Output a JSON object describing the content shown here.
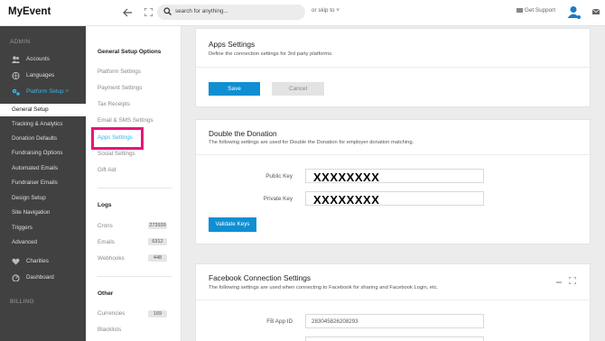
{
  "header": {
    "logo": "MyEvent",
    "search_placeholder": "search for anything...",
    "skip_label": "or skip to ˅",
    "support_label": "Get Support"
  },
  "leftnav": {
    "admin_heading": "ADMIN",
    "accounts": "Accounts",
    "languages": "Languages",
    "platform_setup": "Platform Setup ˅",
    "items": [
      "General Setup",
      "Tracking & Analytics",
      "Donation Defaults",
      "Fundraising Options",
      "Automated Emails",
      "Fundraiser Emails",
      "Design Setup",
      "Site Navigation",
      "Triggers",
      "Advanced"
    ],
    "charities": "Charities",
    "dashboard": "Dashboard",
    "billing_heading": "BILLING"
  },
  "subnav": {
    "general_heading": "General Setup Options",
    "general_links": [
      "Platform Settings",
      "Payment Settings",
      "Tax Receipts",
      "Email & SMS Settings",
      "Apps Settings",
      "Social Settings",
      "Gift Aid"
    ],
    "logs_heading": "Logs",
    "logs": [
      {
        "label": "Crons",
        "count": "273939"
      },
      {
        "label": "Emails",
        "count": "6312"
      },
      {
        "label": "Webhooks",
        "count": "448"
      }
    ],
    "other_heading": "Other",
    "other": [
      {
        "label": "Currencies",
        "count": "169"
      },
      {
        "label": "Blacklists",
        "count": ""
      }
    ]
  },
  "apps": {
    "title": "Apps Settings",
    "subtitle": "Define the connection settings for 3rd party platforms.",
    "save": "Save",
    "cancel": "Cancel"
  },
  "dtd": {
    "title": "Double the Donation",
    "subtitle": "The following settings are used for Double the Donation for employer donation matching.",
    "public_key_label": "Public Key",
    "public_key_value": "XXXXXXXX",
    "private_key_label": "Private Key",
    "private_key_value": "XXXXXXXX",
    "validate": "Validate Keys"
  },
  "facebook": {
    "title": "Facebook Connection Settings",
    "subtitle": "The following settings are used when connecting to Facebook for sharing and Facebook Login, etc.",
    "app_id_label": "FB App ID",
    "app_id_value": "283045826208293"
  },
  "colors": {
    "accent": "#0f8fd2",
    "highlight": "#e8157a",
    "sidebar": "#414141"
  }
}
